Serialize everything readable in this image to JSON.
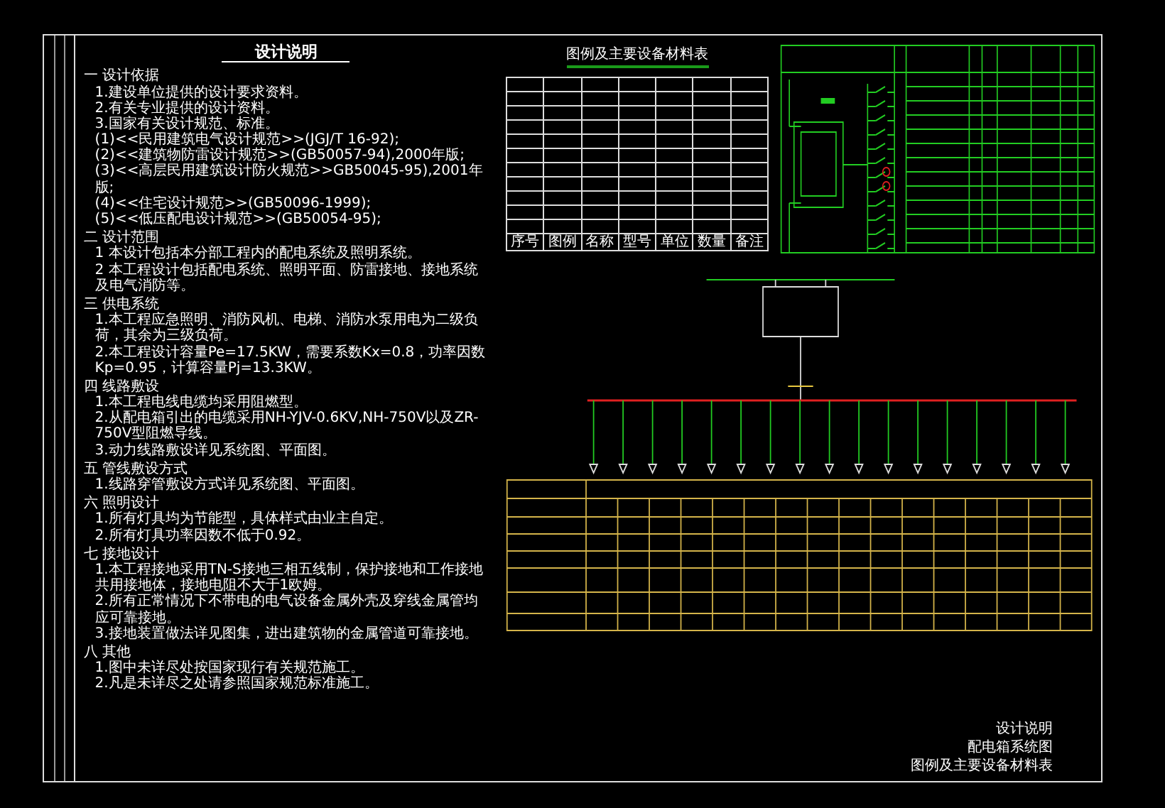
{
  "notes": {
    "title": "设计说明",
    "lines": [
      {
        "kind": "heading",
        "text": "一 设计依据"
      },
      {
        "kind": "item",
        "text": "1.建设单位提供的设计要求资料。"
      },
      {
        "kind": "item",
        "text": "2.有关专业提供的设计资料。"
      },
      {
        "kind": "item",
        "text": "3.国家有关设计规范、标准。"
      },
      {
        "kind": "item",
        "text": "(1)<<民用建筑电气设计规范>>(JGJ/T 16-92);"
      },
      {
        "kind": "item",
        "text": "(2)<<建筑物防雷设计规范>>(GB50057-94),2000年版;"
      },
      {
        "kind": "item",
        "text": "(3)<<高层民用建筑设计防火规范>>GB50045-95),2001年版;"
      },
      {
        "kind": "item",
        "text": "(4)<<住宅设计规范>>(GB50096-1999);"
      },
      {
        "kind": "item",
        "text": "(5)<<低压配电设计规范>>(GB50054-95);"
      },
      {
        "kind": "heading",
        "text": "二 设计范围"
      },
      {
        "kind": "item",
        "text": "1 本设计包括本分部工程内的配电系统及照明系统。"
      },
      {
        "kind": "item",
        "text": "2 本工程设计包括配电系统、照明平面、防雷接地、接地系统及电气消防等。"
      },
      {
        "kind": "heading",
        "text": "三 供电系统"
      },
      {
        "kind": "item",
        "text": "1.本工程应急照明、消防风机、电梯、消防水泵用电为二级负荷，其余为三级负荷。"
      },
      {
        "kind": "item",
        "text": "2.本工程设计容量Pe=17.5KW，需要系数Kx=0.8，功率因数Kp=0.95，计算容量Pj=13.3KW。"
      },
      {
        "kind": "heading",
        "text": "四 线路敷设"
      },
      {
        "kind": "item",
        "text": "1.本工程电线电缆均采用阻燃型。"
      },
      {
        "kind": "item",
        "text": "2.从配电箱引出的电缆采用NH-YJV-0.6KV,NH-750V以及ZR-750V型阻燃导线。"
      },
      {
        "kind": "item",
        "text": "3.动力线路敷设详见系统图、平面图。"
      },
      {
        "kind": "heading",
        "text": "五 管线敷设方式"
      },
      {
        "kind": "item",
        "text": "1.线路穿管敷设方式详见系统图、平面图。"
      },
      {
        "kind": "heading",
        "text": "六 照明设计"
      },
      {
        "kind": "item",
        "text": "1.所有灯具均为节能型，具体样式由业主自定。"
      },
      {
        "kind": "item",
        "text": "2.所有灯具功率因数不低于0.92。"
      },
      {
        "kind": "heading",
        "text": "七 接地设计"
      },
      {
        "kind": "item",
        "text": "1.本工程接地采用TN-S接地三相五线制，保护接地和工作接地共用接地体，接地电阻不大于1欧姆。"
      },
      {
        "kind": "item",
        "text": "2.所有正常情况下不带电的电气设备金属外壳及穿线金属管均应可靠接地。"
      },
      {
        "kind": "item",
        "text": "3.接地装置做法详见图集，进出建筑物的金属管道可靠接地。"
      },
      {
        "kind": "heading",
        "text": "八 其他"
      },
      {
        "kind": "item",
        "text": "1.图中未详尽处按国家现行有关规范施工。"
      },
      {
        "kind": "item",
        "text": "2.凡是未详尽之处请参照国家规范标准施工。"
      }
    ]
  },
  "legend_table": {
    "title": "图例及主要设备材料表",
    "columns": [
      "序号",
      "图例",
      "名称",
      "型号",
      "单位",
      "数量",
      "备注"
    ]
  },
  "title_block": [
    "设计说明",
    "配电箱系统图",
    "图例及主要设备材料表"
  ]
}
